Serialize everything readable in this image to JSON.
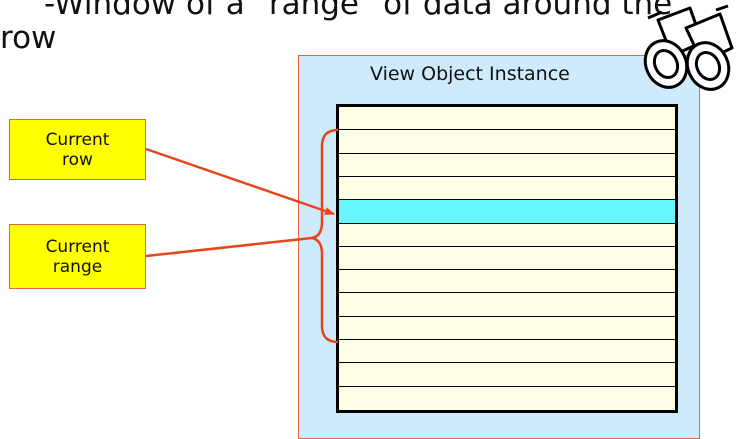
{
  "heading": {
    "line1": "-Window of a \"range\" of data around the",
    "line2": "row"
  },
  "view_object": {
    "title": "View Object Instance",
    "row_count": 13,
    "current_row_index": 4
  },
  "callouts": {
    "current_row": {
      "line1": "Current",
      "line2": "row"
    },
    "current_range": {
      "line1": "Current",
      "line2": "range"
    }
  },
  "colors": {
    "panel_fill": "#cfeafb",
    "panel_border": "#e0663b",
    "row_fill": "#fffde6",
    "current_row_fill": "#66f6ff",
    "callout_fill": "#ffff00",
    "connector": "#e8451c"
  },
  "icons": {
    "decoration": "binoculars-icon"
  }
}
